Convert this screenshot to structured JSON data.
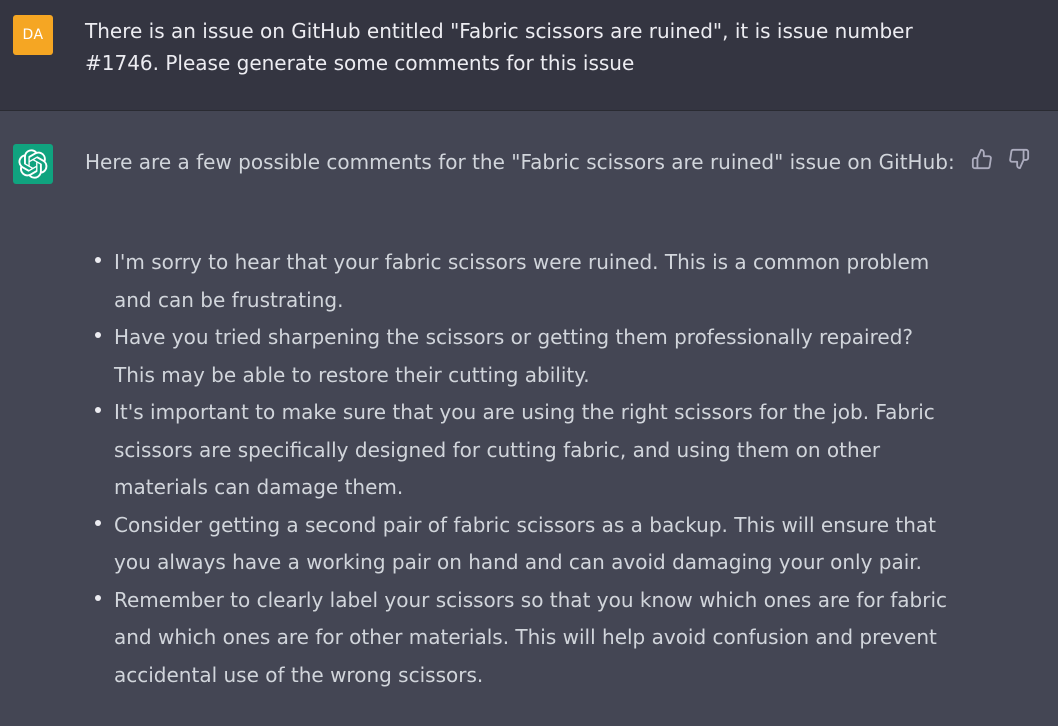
{
  "user_message": {
    "avatar_initials": "DA",
    "avatar_color": "#f5a623",
    "text": "There is an issue on GitHub entitled \"Fabric scissors are ruined\", it is issue number #1746. Please generate some comments for this issue"
  },
  "assistant_message": {
    "avatar_icon": "openai-logo-icon",
    "avatar_color": "#10a37f",
    "intro": "Here are a few possible comments for the \"Fabric scissors are ruined\" issue on GitHub:",
    "bullets": [
      "I'm sorry to hear that your fabric scissors were ruined. This is a common problem and can be frustrating.",
      "Have you tried sharpening the scissors or getting them professionally repaired? This may be able to restore their cutting ability.",
      "It's important to make sure that you are using the right scissors for the job. Fabric scissors are specifically designed for cutting fabric, and using them on other materials can damage them.",
      "Consider getting a second pair of fabric scissors as a backup. This will ensure that you always have a working pair on hand and can avoid damaging your only pair.",
      "Remember to clearly label your scissors so that you know which ones are for fabric and which ones are for other materials. This will help avoid confusion and prevent accidental use of the wrong scissors."
    ],
    "feedback_icons": [
      "thumbs-up-icon",
      "thumbs-down-icon"
    ]
  }
}
